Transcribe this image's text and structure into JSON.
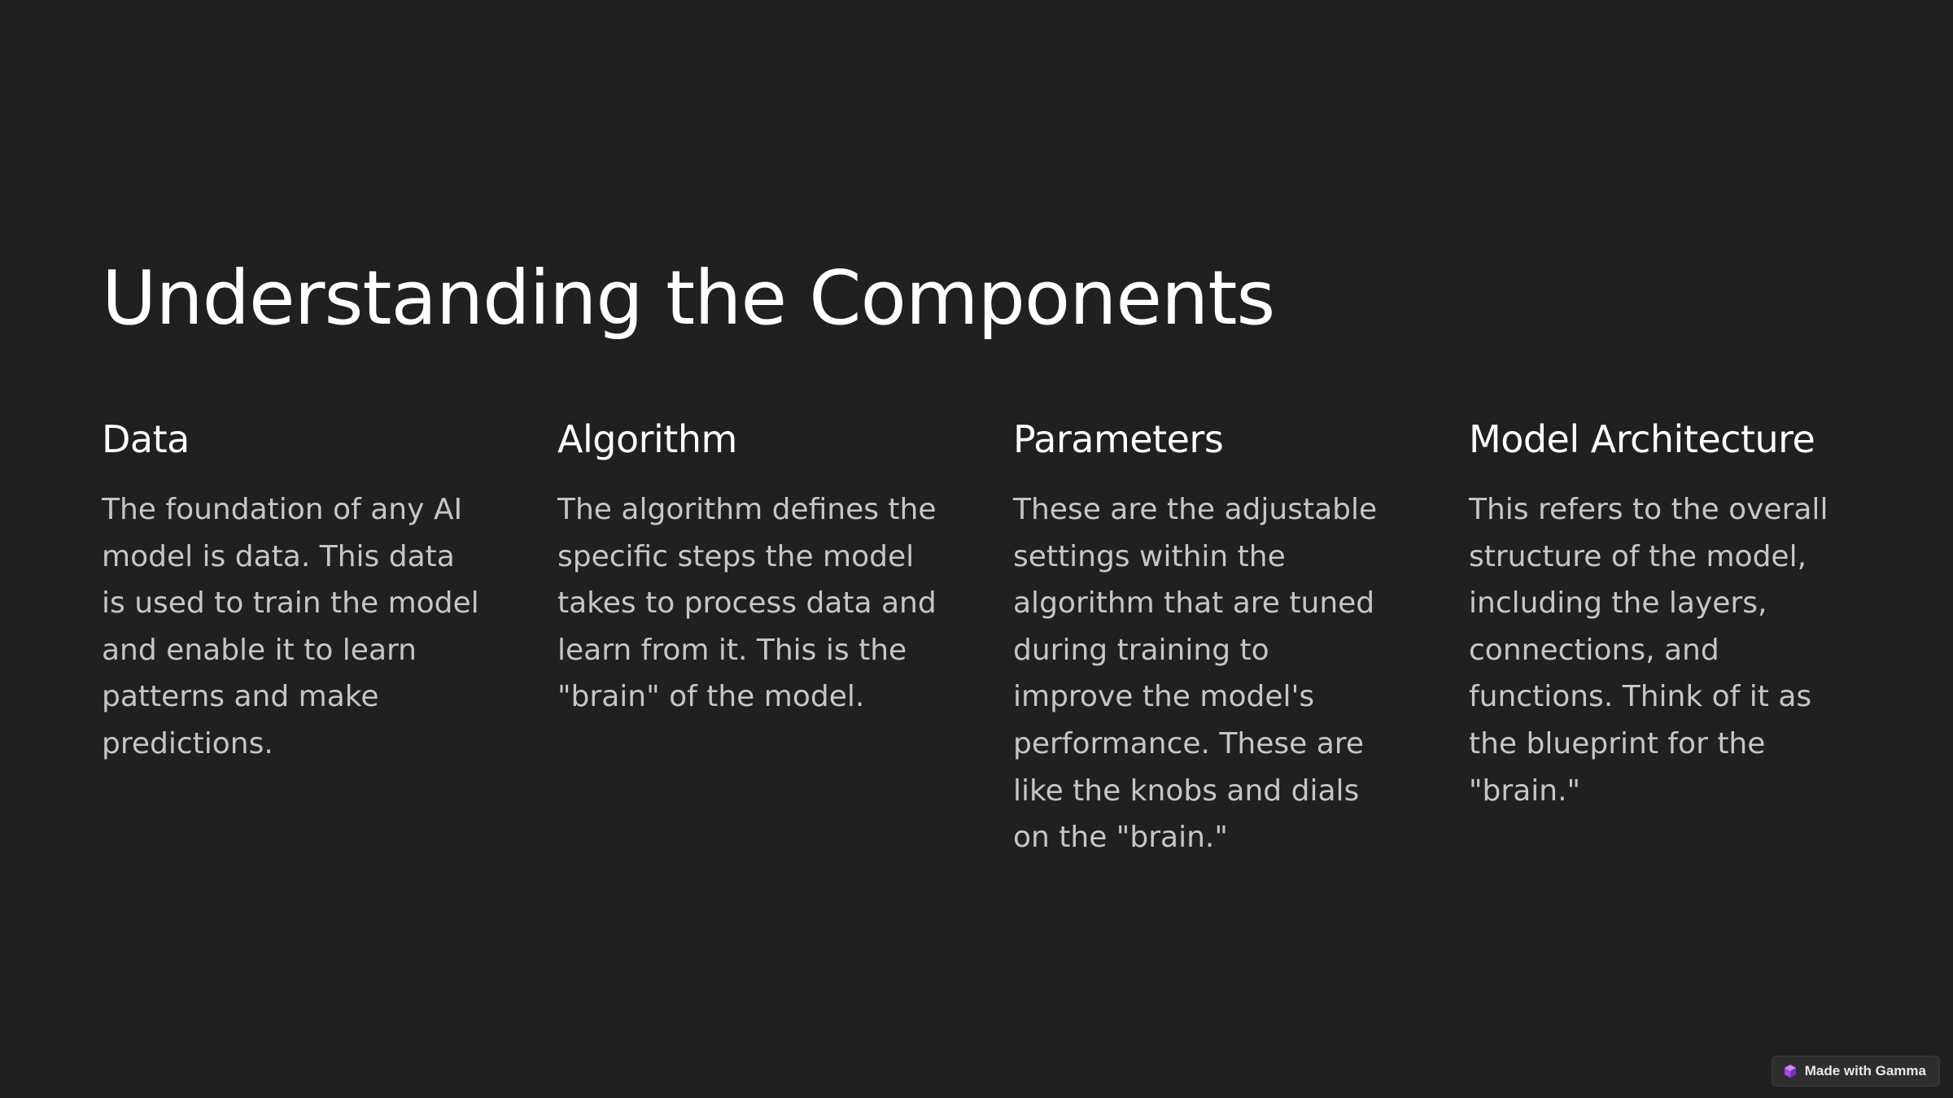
{
  "slide": {
    "title": "Understanding the Components",
    "columns": [
      {
        "heading": "Data",
        "body": "The foundation of any AI model is data. This data is used to train the model and enable it to learn patterns and make predictions."
      },
      {
        "heading": "Algorithm",
        "body": "The algorithm defines the specific steps the model takes to process data and learn from it. This is the \"brain\" of the model."
      },
      {
        "heading": "Parameters",
        "body": "These are the adjustable settings within the algorithm that are tuned during training to improve the model's performance. These are like the knobs and dials on the \"brain.\""
      },
      {
        "heading": "Model Architecture",
        "body": "This refers to the overall structure of the model, including the layers, connections, and functions. Think of it as the blueprint for the \"brain.\""
      }
    ]
  },
  "badge": {
    "label": "Made with Gamma",
    "icon": "gamma-logo-icon"
  },
  "colors": {
    "background": "#202020",
    "heading": "#ffffff",
    "body_text": "#c6c6c6",
    "badge_background": "#2e2e2e",
    "gamma_logo": "#a14ee8"
  }
}
